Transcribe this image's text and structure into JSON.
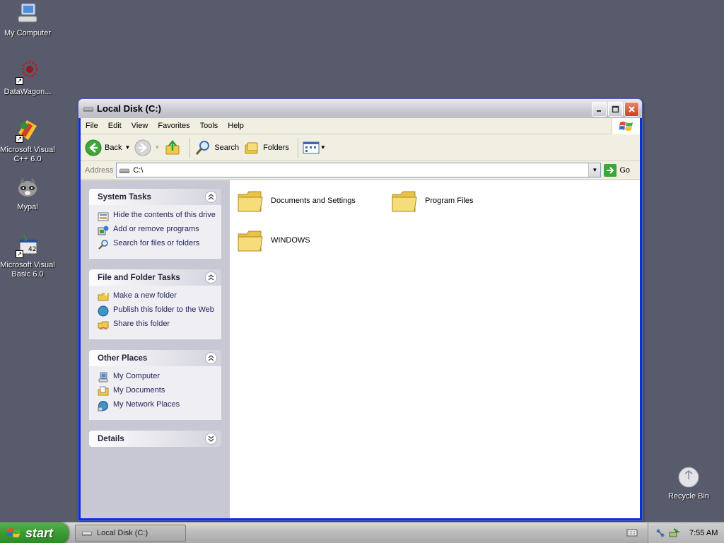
{
  "desktop": {
    "icons": [
      {
        "label": "My Computer"
      },
      {
        "label": "DataWagon..."
      },
      {
        "label": "Microsoft Visual\nC++ 6.0"
      },
      {
        "label": "Mypal"
      },
      {
        "label": "Microsoft Visual\nBasic 6.0"
      },
      {
        "label": "Recycle Bin"
      }
    ]
  },
  "window": {
    "title": "Local Disk (C:)",
    "menu": [
      "File",
      "Edit",
      "View",
      "Favorites",
      "Tools",
      "Help"
    ],
    "toolbar": {
      "back": "Back",
      "search": "Search",
      "folders": "Folders"
    },
    "address": {
      "label": "Address",
      "value": "C:\\",
      "go": "Go"
    },
    "taskpane": {
      "system_tasks": {
        "title": "System Tasks",
        "items": [
          "Hide the contents of this drive",
          "Add or remove programs",
          "Search for files or folders"
        ]
      },
      "file_folder_tasks": {
        "title": "File and Folder Tasks",
        "items": [
          "Make a new folder",
          "Publish this folder to the Web",
          "Share this folder"
        ]
      },
      "other_places": {
        "title": "Other Places",
        "items": [
          "My Computer",
          "My Documents",
          "My Network Places"
        ]
      },
      "details": {
        "title": "Details"
      }
    },
    "folders": [
      {
        "name": "Documents and Settings"
      },
      {
        "name": "Program Files"
      },
      {
        "name": "WINDOWS"
      }
    ]
  },
  "taskbar": {
    "start": "start",
    "task_button": "Local Disk (C:)",
    "clock": "7:55 AM"
  },
  "colors": {
    "desktop_bg": "#585b6c",
    "start_green": "#3c9a35",
    "folder_yellow": "#f5d55a"
  }
}
